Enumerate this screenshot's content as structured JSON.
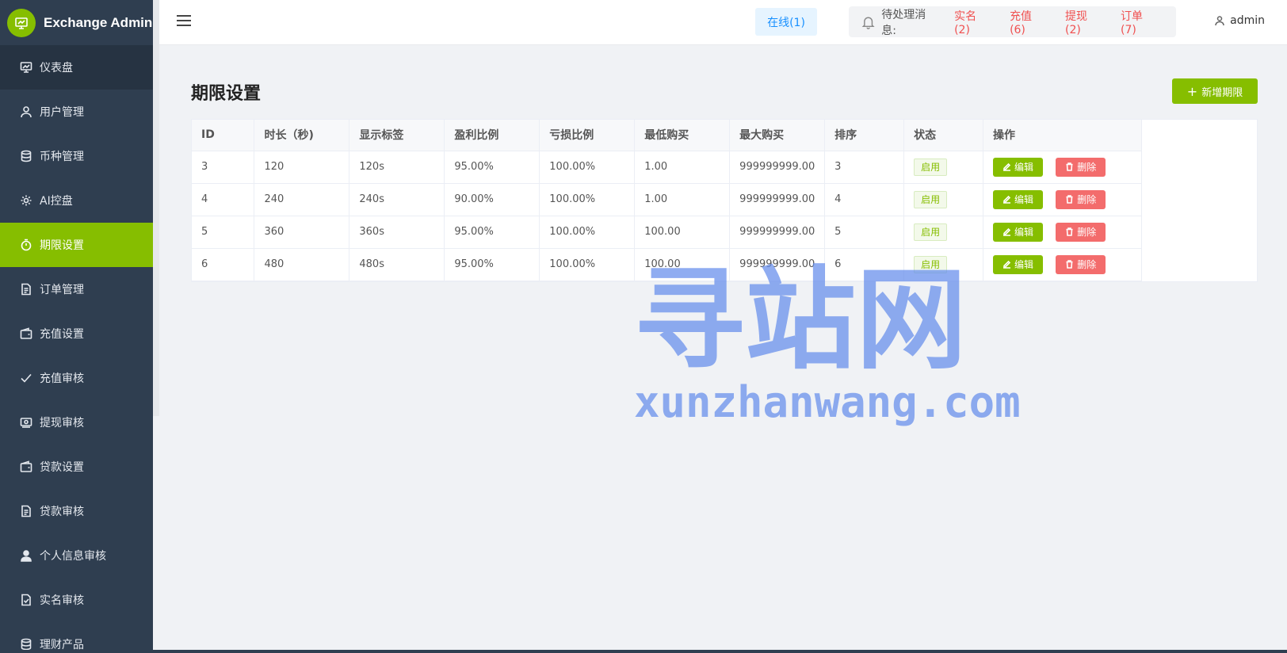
{
  "brand": {
    "title": "Exchange Admin"
  },
  "sidebar": {
    "items": [
      {
        "label": "仪表盘",
        "icon": "dashboard-icon"
      },
      {
        "label": "用户管理",
        "icon": "user-icon"
      },
      {
        "label": "币种管理",
        "icon": "database-icon"
      },
      {
        "label": "AI控盘",
        "icon": "gear-icon"
      },
      {
        "label": "期限设置",
        "icon": "stopwatch-icon"
      },
      {
        "label": "订单管理",
        "icon": "document-icon"
      },
      {
        "label": "充值设置",
        "icon": "wallet-icon"
      },
      {
        "label": "充值审核",
        "icon": "check-icon"
      },
      {
        "label": "提现审核",
        "icon": "cash-icon"
      },
      {
        "label": "贷款设置",
        "icon": "wallet-icon"
      },
      {
        "label": "贷款审核",
        "icon": "document-icon"
      },
      {
        "label": "个人信息审核",
        "icon": "user-filled-icon"
      },
      {
        "label": "实名审核",
        "icon": "document-check-icon"
      },
      {
        "label": "理财产品",
        "icon": "database-icon"
      }
    ]
  },
  "header": {
    "online": "在线(1)",
    "notice_label": "待处理消息:",
    "notices": [
      "实名(2)",
      "充值(6)",
      "提现(2)",
      "订单(7)"
    ],
    "user": "admin"
  },
  "page": {
    "title": "期限设置",
    "add_label": "新增期限"
  },
  "table": {
    "columns": [
      "ID",
      "时长（秒)",
      "显示标签",
      "盈利比例",
      "亏损比例",
      "最低购买",
      "最大购买",
      "排序",
      "状态",
      "操作"
    ],
    "rows": [
      [
        "3",
        "120",
        "120s",
        "95.00%",
        "100.00%",
        "1.00",
        "999999999.00",
        "3",
        "启用"
      ],
      [
        "4",
        "240",
        "240s",
        "90.00%",
        "100.00%",
        "1.00",
        "999999999.00",
        "4",
        "启用"
      ],
      [
        "5",
        "360",
        "360s",
        "95.00%",
        "100.00%",
        "100.00",
        "999999999.00",
        "5",
        "启用"
      ],
      [
        "6",
        "480",
        "480s",
        "95.00%",
        "100.00%",
        "100.00",
        "999999999.00",
        "6",
        "启用"
      ]
    ],
    "edit_label": "编辑",
    "delete_label": "删除"
  },
  "watermark": {
    "cn": "寻站网",
    "en": "xunzhanwang.com"
  },
  "colors": {
    "accent": "#86be00",
    "sidebar": "#2f3e50",
    "danger": "#f36c6c",
    "online": "#1890ff"
  }
}
